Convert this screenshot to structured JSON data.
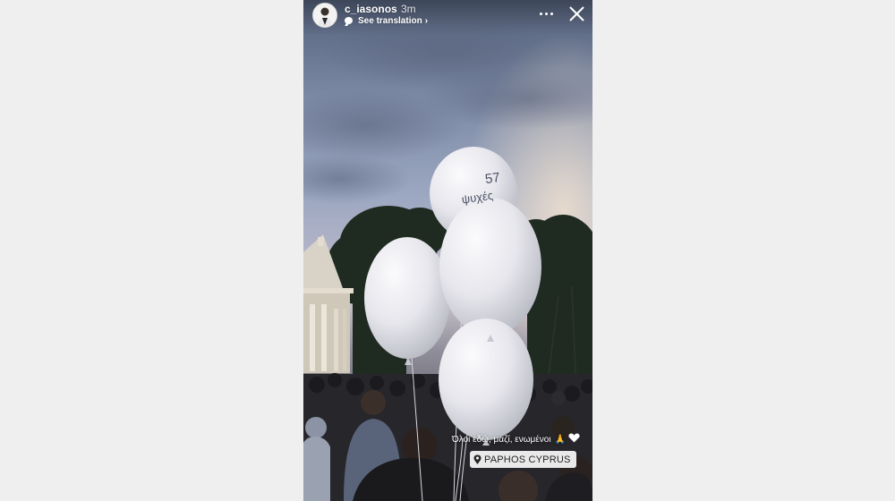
{
  "story": {
    "username": "c_iasonos",
    "time_ago": "3m",
    "see_translation": "See translation",
    "caption_text": "Όλοι εδώ, μαζί, ενωμένοι",
    "caption_emoji": "🙏",
    "location": "PAPHOS CYPRUS",
    "balloon_text_line1": "57",
    "balloon_text_line2": "ψυχές"
  },
  "icons": {
    "avatar": "avatar-icon",
    "translation": "speech-bubble-icon",
    "chevron": "chevron-right-icon",
    "more": "more-dots-icon",
    "close": "close-icon",
    "location": "location-pin-icon",
    "heart": "white-heart-icon",
    "pray": "praying-hands-icon"
  },
  "colors": {
    "background": "#efefef",
    "overlay_text": "#ffffff",
    "sticker_bg": "#ffffff",
    "sticker_text": "#262626"
  }
}
